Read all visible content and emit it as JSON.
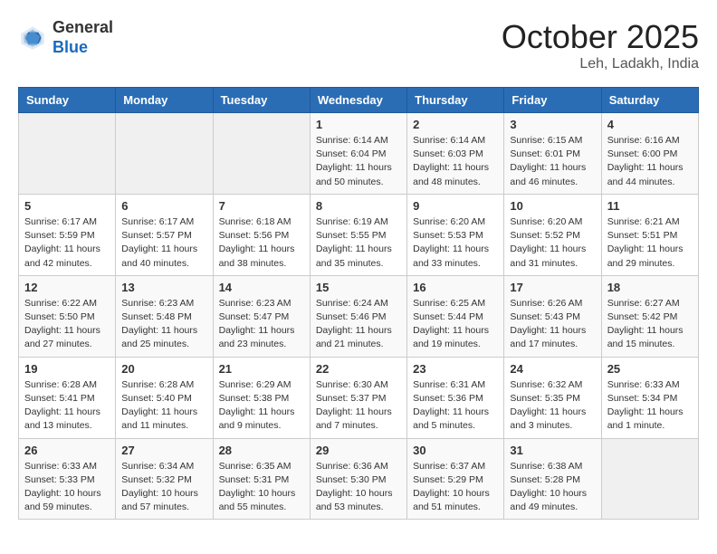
{
  "header": {
    "logo_line1": "General",
    "logo_line2": "Blue",
    "month": "October 2025",
    "location": "Leh, Ladakh, India"
  },
  "weekdays": [
    "Sunday",
    "Monday",
    "Tuesday",
    "Wednesday",
    "Thursday",
    "Friday",
    "Saturday"
  ],
  "weeks": [
    [
      {
        "day": "",
        "info": ""
      },
      {
        "day": "",
        "info": ""
      },
      {
        "day": "",
        "info": ""
      },
      {
        "day": "1",
        "info": "Sunrise: 6:14 AM\nSunset: 6:04 PM\nDaylight: 11 hours\nand 50 minutes."
      },
      {
        "day": "2",
        "info": "Sunrise: 6:14 AM\nSunset: 6:03 PM\nDaylight: 11 hours\nand 48 minutes."
      },
      {
        "day": "3",
        "info": "Sunrise: 6:15 AM\nSunset: 6:01 PM\nDaylight: 11 hours\nand 46 minutes."
      },
      {
        "day": "4",
        "info": "Sunrise: 6:16 AM\nSunset: 6:00 PM\nDaylight: 11 hours\nand 44 minutes."
      }
    ],
    [
      {
        "day": "5",
        "info": "Sunrise: 6:17 AM\nSunset: 5:59 PM\nDaylight: 11 hours\nand 42 minutes."
      },
      {
        "day": "6",
        "info": "Sunrise: 6:17 AM\nSunset: 5:57 PM\nDaylight: 11 hours\nand 40 minutes."
      },
      {
        "day": "7",
        "info": "Sunrise: 6:18 AM\nSunset: 5:56 PM\nDaylight: 11 hours\nand 38 minutes."
      },
      {
        "day": "8",
        "info": "Sunrise: 6:19 AM\nSunset: 5:55 PM\nDaylight: 11 hours\nand 35 minutes."
      },
      {
        "day": "9",
        "info": "Sunrise: 6:20 AM\nSunset: 5:53 PM\nDaylight: 11 hours\nand 33 minutes."
      },
      {
        "day": "10",
        "info": "Sunrise: 6:20 AM\nSunset: 5:52 PM\nDaylight: 11 hours\nand 31 minutes."
      },
      {
        "day": "11",
        "info": "Sunrise: 6:21 AM\nSunset: 5:51 PM\nDaylight: 11 hours\nand 29 minutes."
      }
    ],
    [
      {
        "day": "12",
        "info": "Sunrise: 6:22 AM\nSunset: 5:50 PM\nDaylight: 11 hours\nand 27 minutes."
      },
      {
        "day": "13",
        "info": "Sunrise: 6:23 AM\nSunset: 5:48 PM\nDaylight: 11 hours\nand 25 minutes."
      },
      {
        "day": "14",
        "info": "Sunrise: 6:23 AM\nSunset: 5:47 PM\nDaylight: 11 hours\nand 23 minutes."
      },
      {
        "day": "15",
        "info": "Sunrise: 6:24 AM\nSunset: 5:46 PM\nDaylight: 11 hours\nand 21 minutes."
      },
      {
        "day": "16",
        "info": "Sunrise: 6:25 AM\nSunset: 5:44 PM\nDaylight: 11 hours\nand 19 minutes."
      },
      {
        "day": "17",
        "info": "Sunrise: 6:26 AM\nSunset: 5:43 PM\nDaylight: 11 hours\nand 17 minutes."
      },
      {
        "day": "18",
        "info": "Sunrise: 6:27 AM\nSunset: 5:42 PM\nDaylight: 11 hours\nand 15 minutes."
      }
    ],
    [
      {
        "day": "19",
        "info": "Sunrise: 6:28 AM\nSunset: 5:41 PM\nDaylight: 11 hours\nand 13 minutes."
      },
      {
        "day": "20",
        "info": "Sunrise: 6:28 AM\nSunset: 5:40 PM\nDaylight: 11 hours\nand 11 minutes."
      },
      {
        "day": "21",
        "info": "Sunrise: 6:29 AM\nSunset: 5:38 PM\nDaylight: 11 hours\nand 9 minutes."
      },
      {
        "day": "22",
        "info": "Sunrise: 6:30 AM\nSunset: 5:37 PM\nDaylight: 11 hours\nand 7 minutes."
      },
      {
        "day": "23",
        "info": "Sunrise: 6:31 AM\nSunset: 5:36 PM\nDaylight: 11 hours\nand 5 minutes."
      },
      {
        "day": "24",
        "info": "Sunrise: 6:32 AM\nSunset: 5:35 PM\nDaylight: 11 hours\nand 3 minutes."
      },
      {
        "day": "25",
        "info": "Sunrise: 6:33 AM\nSunset: 5:34 PM\nDaylight: 11 hours\nand 1 minute."
      }
    ],
    [
      {
        "day": "26",
        "info": "Sunrise: 6:33 AM\nSunset: 5:33 PM\nDaylight: 10 hours\nand 59 minutes."
      },
      {
        "day": "27",
        "info": "Sunrise: 6:34 AM\nSunset: 5:32 PM\nDaylight: 10 hours\nand 57 minutes."
      },
      {
        "day": "28",
        "info": "Sunrise: 6:35 AM\nSunset: 5:31 PM\nDaylight: 10 hours\nand 55 minutes."
      },
      {
        "day": "29",
        "info": "Sunrise: 6:36 AM\nSunset: 5:30 PM\nDaylight: 10 hours\nand 53 minutes."
      },
      {
        "day": "30",
        "info": "Sunrise: 6:37 AM\nSunset: 5:29 PM\nDaylight: 10 hours\nand 51 minutes."
      },
      {
        "day": "31",
        "info": "Sunrise: 6:38 AM\nSunset: 5:28 PM\nDaylight: 10 hours\nand 49 minutes."
      },
      {
        "day": "",
        "info": ""
      }
    ]
  ]
}
